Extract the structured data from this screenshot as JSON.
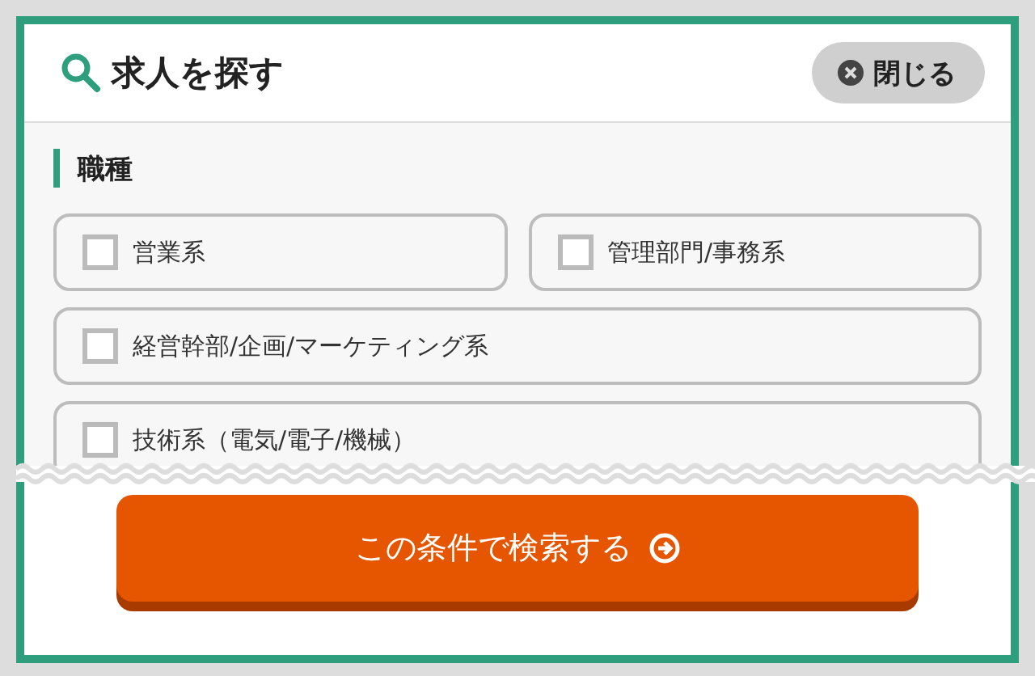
{
  "header": {
    "title": "求人を探す",
    "close_button": "閉じる"
  },
  "section": {
    "title": "職種",
    "options": [
      {
        "label": "営業系",
        "checked": false,
        "wide": false
      },
      {
        "label": "管理部門/事務系",
        "checked": false,
        "wide": false
      },
      {
        "label": "経営幹部/企画/マーケティング系",
        "checked": false,
        "wide": true
      },
      {
        "label": "技術系（電気/電子/機械）",
        "checked": false,
        "wide": true
      }
    ]
  },
  "search_button": "この条件で検索する"
}
